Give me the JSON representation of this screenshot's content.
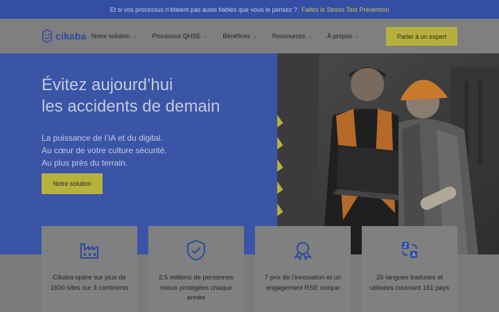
{
  "topbar": {
    "text": "Et si vos processus n'étaient pas aussi fiables que vous le pensez ?",
    "cta": "Faites le Stress Test Prévention"
  },
  "nav": {
    "logo": "cikaba",
    "items": [
      {
        "label": "Notre solution"
      },
      {
        "label": "Processus QHSE"
      },
      {
        "label": "Bénéfices"
      },
      {
        "label": "Ressources"
      },
      {
        "label": "À propos"
      }
    ],
    "cta": "Parler à un expert"
  },
  "hero": {
    "title_line1": "Évitez aujourd’hui",
    "title_line2": "les accidents de demain",
    "lines": [
      "La puissance de l’IA et du digital.",
      "Au cœur de votre culture sécurité.",
      "Au plus près du terrain."
    ],
    "button": "Notre solution"
  },
  "stats": [
    {
      "icon": "factory-icon",
      "text": "Cikaba opère sur plus de 1600 sites sur 3 continents"
    },
    {
      "icon": "shield-check-icon",
      "text": "2,5 millions de personnes mieux protégées chaque année"
    },
    {
      "icon": "award-icon",
      "text": "7 prix de l’innovation et un engagement RSE unique"
    },
    {
      "icon": "translate-icon",
      "text": "26 langues traduites et utilisées couvrant 161 pays"
    }
  ],
  "colors": {
    "brand": "#344ea4",
    "accent": "#b7b13d"
  }
}
